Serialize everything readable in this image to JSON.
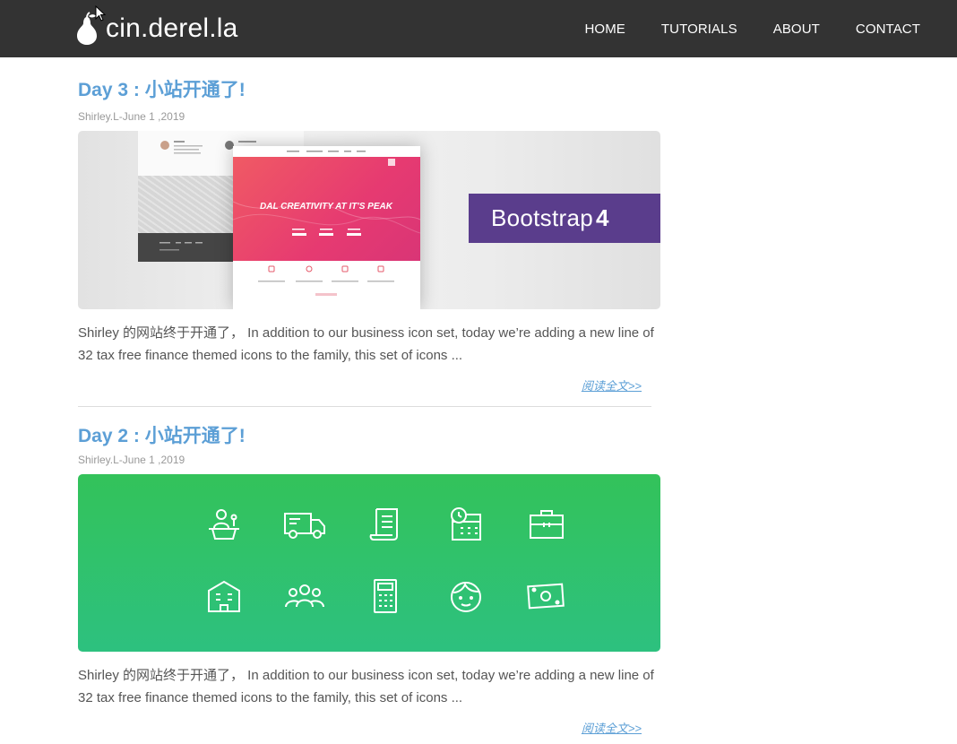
{
  "site": {
    "brand_name": "cin.derel.la",
    "logo_icon": "pear-icon",
    "nav": [
      "HOME",
      "TUTORIALS",
      "ABOUT",
      "CONTACT"
    ]
  },
  "posts": [
    {
      "title": "Day 3 : 小站开通了!",
      "meta": "Shirley.L-June 1 ,2019",
      "image": {
        "mockup_hero_text": "DAL CREATIVITY AT IT'S PEAK",
        "banner_text": "Bootstrap",
        "banner_num": "4"
      },
      "excerpt": "Shirley 的网站终于开通了， In addition to our business icon set, today we’re adding a new line of 32 tax free finance themed icons to the family, this set of icons ...",
      "read_more": "阅读全文>>"
    },
    {
      "title": "Day 2 : 小站开通了!",
      "meta": "Shirley.L-June 1 ,2019",
      "image": {
        "icons": [
          "desk-person-icon",
          "delivery-truck-icon",
          "receipt-icon",
          "calendar-clock-icon",
          "briefcase-icon",
          "office-building-icon",
          "team-icon",
          "calculator-icon",
          "face-icon",
          "banknote-icon"
        ]
      },
      "excerpt": "Shirley 的网站终于开通了， In addition to our business icon set, today we’re adding a new line of 32 tax free finance themed icons to the family, this set of icons ...",
      "read_more": "阅读全文>>"
    }
  ],
  "colors": {
    "navbar": "#333333",
    "title_blue": "#5c9fd6",
    "bootstrap_purple": "#5a3d8c",
    "green_card": "#33c25a"
  }
}
